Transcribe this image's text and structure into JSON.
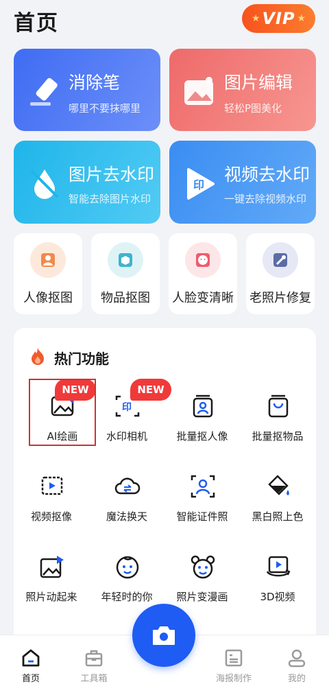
{
  "header": {
    "title": "首页",
    "vip_label": "VIP"
  },
  "top_cards": [
    {
      "title": "消除笔",
      "subtitle": "哪里不要抹哪里",
      "icon": "eraser-pen-icon"
    },
    {
      "title": "图片编辑",
      "subtitle": "轻松P图美化",
      "icon": "image-edit-icon"
    },
    {
      "title": "图片去水印",
      "subtitle": "智能去除图片水印",
      "icon": "drop-remove-icon"
    },
    {
      "title": "视频去水印",
      "subtitle": "一键去除视频水印",
      "icon": "video-watermark-icon"
    }
  ],
  "quick_tools": [
    {
      "label": "人像抠图",
      "icon": "portrait-cutout-icon"
    },
    {
      "label": "物品抠图",
      "icon": "object-cutout-icon"
    },
    {
      "label": "人脸变清晰",
      "icon": "face-enhance-icon"
    },
    {
      "label": "老照片修复",
      "icon": "photo-repair-icon"
    }
  ],
  "hot": {
    "title": "热门功能",
    "badge": "NEW",
    "features": [
      {
        "label": "AI绘画",
        "icon": "ai-paint-icon"
      },
      {
        "label": "水印相机",
        "icon": "watermark-camera-icon"
      },
      {
        "label": "批量抠人像",
        "icon": "batch-portrait-icon"
      },
      {
        "label": "批量抠物品",
        "icon": "batch-object-icon"
      },
      {
        "label": "视频抠像",
        "icon": "video-cutout-icon"
      },
      {
        "label": "魔法换天",
        "icon": "sky-swap-icon"
      },
      {
        "label": "智能证件照",
        "icon": "id-photo-icon"
      },
      {
        "label": "黑白照上色",
        "icon": "colorize-icon"
      },
      {
        "label": "照片动起来",
        "icon": "photo-animate-icon"
      },
      {
        "label": "年轻时的你",
        "icon": "young-face-icon"
      },
      {
        "label": "照片变漫画",
        "icon": "cartoon-icon"
      },
      {
        "label": "3D视频",
        "icon": "3d-video-icon"
      }
    ]
  },
  "tabbar": [
    {
      "label": "首页",
      "icon": "home-icon"
    },
    {
      "label": "工具箱",
      "icon": "toolbox-icon"
    },
    {
      "label": "海报制作",
      "icon": "poster-icon"
    },
    {
      "label": "我的",
      "icon": "profile-icon"
    }
  ],
  "colors": {
    "accent": "#1e5cf4",
    "vip": "#f8521e",
    "badge": "#f03a3a"
  }
}
